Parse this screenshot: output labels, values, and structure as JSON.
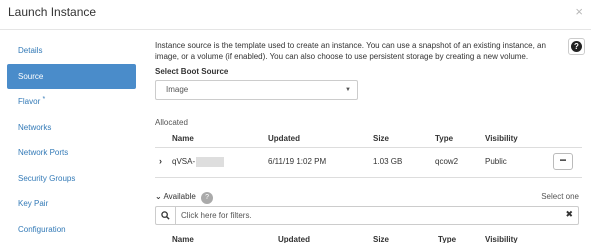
{
  "modal": {
    "title": "Launch Instance",
    "close_glyph": "×"
  },
  "nav": {
    "items": [
      {
        "label": "Details"
      },
      {
        "label": "Source"
      },
      {
        "label": "Flavor",
        "required_marker": "*"
      },
      {
        "label": "Networks"
      },
      {
        "label": "Network Ports"
      },
      {
        "label": "Security Groups"
      },
      {
        "label": "Key Pair"
      },
      {
        "label": "Configuration"
      }
    ],
    "active_index": 1
  },
  "help": {
    "glyph": "?"
  },
  "description": "Instance source is the template used to create an instance. You can use a snapshot of an existing instance, an image, or a volume (if enabled). You can also choose to use persistent storage by creating a new volume.",
  "boot_source": {
    "label": "Select Boot Source",
    "selected": "Image"
  },
  "allocated": {
    "label": "Allocated",
    "columns": [
      "Name",
      "Updated",
      "Size",
      "Type",
      "Visibility"
    ],
    "rows": [
      {
        "name": "qVSA-",
        "updated": "6/11/19 1:02 PM",
        "size": "1.03 GB",
        "type": "qcow2",
        "visibility": "Public"
      }
    ],
    "remove_glyph": "−"
  },
  "available": {
    "label": "Available",
    "count_badge": "?",
    "select_hint": "Select one",
    "filter_placeholder": "Click here for filters.",
    "clear_glyph": "✖",
    "columns": [
      "Name",
      "Updated",
      "Size",
      "Type",
      "Visibility"
    ]
  },
  "colors": {
    "active_nav": "#4a8cca",
    "link": "#337ab7"
  },
  "icons": {
    "expand": "chevron-right-icon",
    "available_toggle": "chevron-down-icon",
    "filter": "search-icon",
    "clear": "clear-x-icon",
    "help": "question-circle-icon"
  }
}
